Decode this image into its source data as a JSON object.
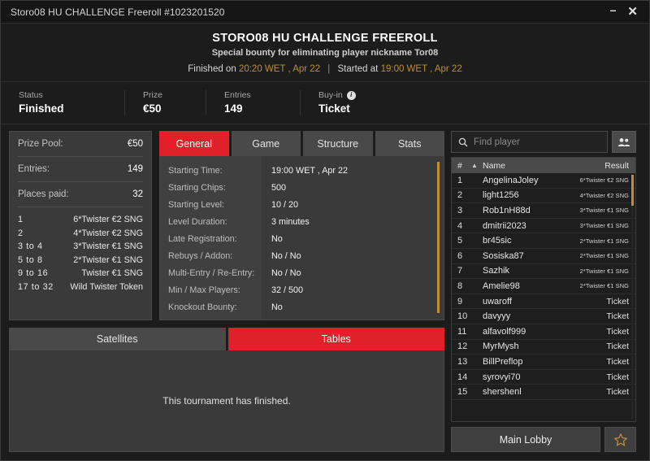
{
  "window": {
    "titlebar_text": "Storo08 HU CHALLENGE Freeroll #1023201520",
    "minimize_label": "–",
    "close_label": "✕"
  },
  "header": {
    "title": "STORO08 HU CHALLENGE FREEROLL",
    "subtitle": "Special bounty for eliminating player nickname Tor08",
    "finished_prefix": "Finished on",
    "finished_time": "20:20 WET , Apr 22",
    "separator": "|",
    "started_prefix": "Started at",
    "started_time": "19:00 WET , Apr 22",
    "accent_gold": "#c08e34"
  },
  "stats": [
    {
      "label": "Status",
      "value": "Finished",
      "icon": null
    },
    {
      "label": "Prize",
      "value": "€50",
      "icon": null
    },
    {
      "label": "Entries",
      "value": "149",
      "icon": null
    },
    {
      "label": "Buy-in",
      "value": "Ticket",
      "icon": "info-icon"
    }
  ],
  "prize_panel": {
    "rows": [
      {
        "key": "Prize Pool:",
        "value": "€50"
      },
      {
        "key": "Entries:",
        "value": "149"
      },
      {
        "key": "Places paid:",
        "value": "32"
      }
    ],
    "payouts": [
      {
        "place": "1",
        "award": "6*Twister €2 SNG"
      },
      {
        "place": "2",
        "award": "4*Twister €2 SNG"
      },
      {
        "place": "3  to  4",
        "award": "3*Twister €1 SNG"
      },
      {
        "place": "5  to  8",
        "award": "2*Twister €1 SNG"
      },
      {
        "place": "9  to  16",
        "award": "Twister €1 SNG"
      },
      {
        "place": "17  to  32",
        "award": "Wild Twister Token"
      }
    ]
  },
  "tabs": {
    "items": [
      {
        "label": "General",
        "active": true
      },
      {
        "label": "Game",
        "active": false
      },
      {
        "label": "Structure",
        "active": false
      },
      {
        "label": "Stats",
        "active": false
      }
    ],
    "active_color": "#e0212a"
  },
  "general_details": [
    {
      "label": "Starting Time:",
      "value": "19:00 WET , Apr 22"
    },
    {
      "label": "Starting Chips:",
      "value": "500"
    },
    {
      "label": "Starting Level:",
      "value": "10 / 20"
    },
    {
      "label": "Level Duration:",
      "value": "3 minutes"
    },
    {
      "label": "Late Registration:",
      "value": "No"
    },
    {
      "label": "Rebuys / Addon:",
      "value": "No / No"
    },
    {
      "label": "Multi-Entry / Re-Entry:",
      "value": "No / No"
    },
    {
      "label": "Min / Max Players:",
      "value": "32 / 500"
    },
    {
      "label": "Knockout Bounty:",
      "value": "No"
    }
  ],
  "lower_tabs": {
    "items": [
      {
        "label": "Satellites",
        "active": false
      },
      {
        "label": "Tables",
        "active": true
      }
    ],
    "message": "This tournament has finished."
  },
  "player_panel": {
    "search_placeholder": "Find player",
    "search_value": "",
    "search_icon": "search-icon",
    "people_icon": "people-icon",
    "columns": {
      "num": "#",
      "sort": "▲",
      "name": "Name",
      "result": "Result"
    },
    "rows": [
      {
        "num": "1",
        "name": "AngelinaJoley",
        "result": "6*Twister €2 SNG",
        "small": true
      },
      {
        "num": "2",
        "name": "light1256",
        "result": "4*Twister €2 SNG",
        "small": true
      },
      {
        "num": "3",
        "name": "Rob1nH88d",
        "result": "3*Twister €1 SNG",
        "small": true
      },
      {
        "num": "4",
        "name": "dmitrii2023",
        "result": "3*Twister €1 SNG",
        "small": true
      },
      {
        "num": "5",
        "name": "br45sic",
        "result": "2*Twister €1 SNG",
        "small": true
      },
      {
        "num": "6",
        "name": "Sosiska87",
        "result": "2*Twister €1 SNG",
        "small": true
      },
      {
        "num": "7",
        "name": "Sazhik",
        "result": "2*Twister €1 SNG",
        "small": true
      },
      {
        "num": "8",
        "name": "Amelie98",
        "result": "2*Twister €1 SNG",
        "small": true
      },
      {
        "num": "9",
        "name": "uwaroff",
        "result": "Ticket",
        "small": false
      },
      {
        "num": "10",
        "name": "davyyy",
        "result": "Ticket",
        "small": false
      },
      {
        "num": "11",
        "name": "alfavolf999",
        "result": "Ticket",
        "small": false
      },
      {
        "num": "12",
        "name": "MyrMysh",
        "result": "Ticket",
        "small": false
      },
      {
        "num": "13",
        "name": "BillPreflop",
        "result": "Ticket",
        "small": false
      },
      {
        "num": "14",
        "name": "syrovyi70",
        "result": "Ticket",
        "small": false
      },
      {
        "num": "15",
        "name": "shershenl",
        "result": "Ticket",
        "small": false
      }
    ]
  },
  "footer": {
    "main_lobby_label": "Main Lobby",
    "favorite_icon": "star-icon"
  }
}
